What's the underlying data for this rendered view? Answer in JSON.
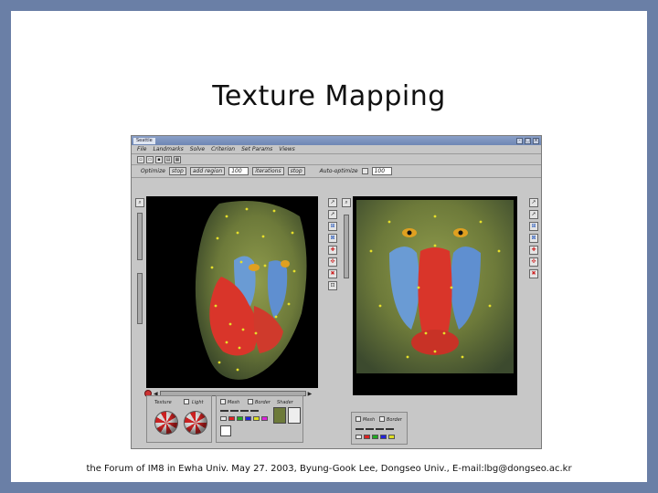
{
  "slide": {
    "title": "Texture Mapping",
    "footer": "the Forum of IM8 in Ewha Univ. May 27. 2003, Byung-Gook Lee, Dongseo Univ., E-mail:lbg@dongseo.ac.kr"
  },
  "app": {
    "window_title": "Seattle",
    "menu": [
      "File",
      "Landmarks",
      "Solve",
      "Criterion",
      "Set Params",
      "Views"
    ],
    "optbar": {
      "optimize_label": "Optimize",
      "stop_label": "stop",
      "add_label": "add region",
      "field1_value": "100",
      "iter_label": "iterations",
      "stop2_label": "stop",
      "auto_label": "Auto-optimize",
      "field2_value": "100"
    },
    "bottom": {
      "texture_label": "Texture",
      "light_label": "Light",
      "mesh_label": "Mesh",
      "border_label": "Border",
      "shader_label": "Shader",
      "mesh2_label": "Mesh",
      "border2_label": "Border"
    }
  },
  "colors": {
    "slide_frame": "#6a7fa6",
    "window_bg": "#c7c7c7",
    "titlebar": "#6e86b4",
    "face_red": "#d9352a",
    "face_blue": "#5f8fd0",
    "fur_olive": "#6d7a3a",
    "landmark_yellow": "#e6df2a"
  }
}
